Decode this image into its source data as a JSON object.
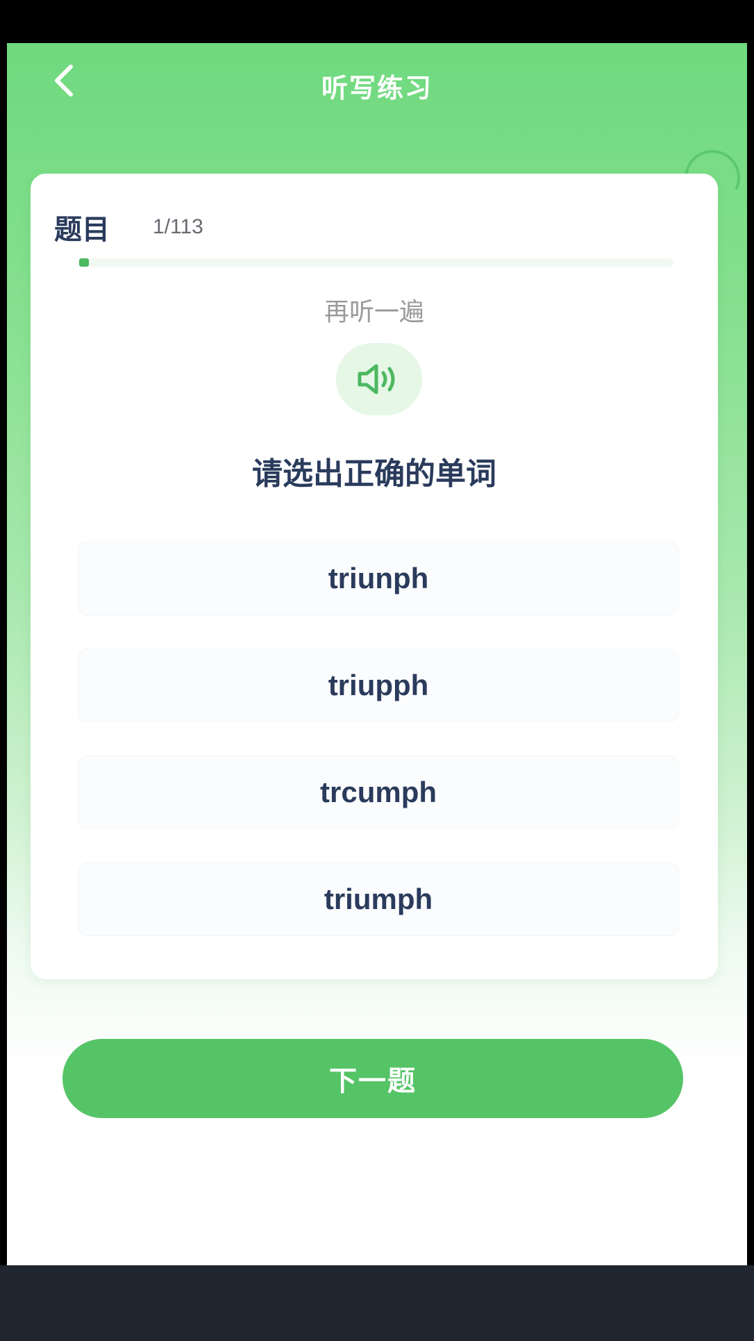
{
  "header": {
    "title": "听写练习",
    "back_icon": "chevron-left-icon"
  },
  "question": {
    "label": "题目",
    "counter": "1/113",
    "progress_fraction": 0.009
  },
  "audio": {
    "relisten_label": "再听一遍",
    "speaker_icon": "speaker-icon"
  },
  "instruction": "请选出正确的单词",
  "options": [
    {
      "text": "triunph"
    },
    {
      "text": "triupph"
    },
    {
      "text": "trcumph"
    },
    {
      "text": "triumph"
    }
  ],
  "next_button": {
    "label": "下一题"
  },
  "colors": {
    "primary_green": "#55c466",
    "text_dark": "#2a3b5c",
    "text_muted": "#9a9a9a"
  }
}
